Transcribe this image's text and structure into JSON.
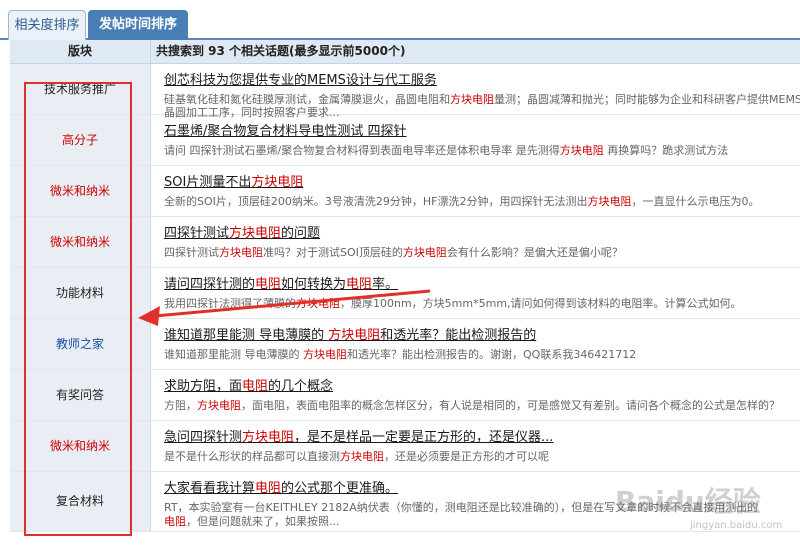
{
  "tabs": [
    {
      "label": "相关度排序"
    },
    {
      "label": "发帖时间排序"
    }
  ],
  "header": {
    "category_label": "版块",
    "results_label": "共搜索到 93 个相关话题(最多显示前5000个)"
  },
  "rows": [
    {
      "category": "技术服务推广",
      "title": "创芯科技为您提供专业的MEMS设计与代工服务",
      "desc_a": "硅基氧化硅和氮化硅膜厚测试，金属薄膜退火，晶圆电阻和",
      "desc_hl": "方块电阻",
      "desc_b": "量测；晶圆减薄和抛光；同时能够为企业和科研客户提供MEMS传感器的设计",
      "desc2": "晶圆加工工序，同时按照客户要求..."
    },
    {
      "category": "高分子",
      "title": "石墨烯/聚合物复合材料导电性测试 四探针",
      "desc_a": "请问 四探针测试石墨烯/聚合物复合材料得到表面电导率还是体积电导率 是先测得",
      "desc_hl": "方块电阻",
      "desc_b": " 再换算吗？跪求测试方法"
    },
    {
      "category": "微米和纳米",
      "title_a": "SOI片测量不出",
      "title_hl": "方块电阻",
      "desc_a": "全新的SOI片，顶层硅200纳米。3号液清洗29分钟，HF漂洗2分钟，用四探针无法测出",
      "desc_hl": "方块电阻",
      "desc_b": "，一直显什么示电压为0。"
    },
    {
      "category": "微米和纳米",
      "title_a": "四探针测试",
      "title_hl": "方块电阻",
      "title_b": "的问题",
      "desc_a": "四探针测试",
      "desc_hl": "方块电阻",
      "desc_b": "准吗？对于测试SOI顶层硅的",
      "desc_hl2": "方块电阻",
      "desc_c": "会有什么影响？是偏大还是偏小呢？"
    },
    {
      "category": "功能材料",
      "title_a": "请问四探针测的",
      "title_hl": "电阻",
      "title_b": "如何转换为",
      "title_hl2": "电阻",
      "title_c": "率。",
      "desc_a": "我用四探针法测得了薄膜的",
      "desc_hl": "方块电阻",
      "desc_b": "，膜厚100nm，方块5mm*5mm,请问如何得到该材料的电阻率。计算公式如何。"
    },
    {
      "category": "教师之家",
      "title_a": "谁知道那里能测 导电薄膜的 ",
      "title_hl": "方块电阻",
      "title_b": "和透光率？能出检测报告的",
      "desc_a": "谁知道那里能测 导电薄膜的 ",
      "desc_hl": "方块电阻",
      "desc_b": "和透光率？能出检测报告的。谢谢，QQ联系我346421712"
    },
    {
      "category": "有奖问答",
      "title_a": "求助方阻，面",
      "title_hl": "电阻",
      "title_b": "的几个概念",
      "desc_a": "方阻，",
      "desc_hl": "方块电阻",
      "desc_b": "，面电阻，表面电阻率的概念怎样区分，有人说是相同的，可是感觉又有差别。请问各个概念的公式是怎样的？"
    },
    {
      "category": "微米和纳米",
      "title_a": "急问四探针测",
      "title_hl": "方块电阻",
      "title_b": "，是不是样品一定要是正方形的，还是仪器...",
      "desc_a": "是不是什么形状的样品都可以直接测",
      "desc_hl": "方块电阻",
      "desc_b": "，还是必须要是正方形的才可以呢"
    },
    {
      "category": "复合材料",
      "title_a": "大家看看我计算",
      "title_hl": "电阻",
      "title_b": "的公式那个更准确。",
      "desc_a": "RT，本实验室有一台KEITHLEY 2182A纳伏表（你懂的，测电阻还是比较准确的），但是在写文章的时候不会直接用测出的",
      "desc2_hl": "电阻",
      "desc2": "，但是问题就来了，如果按照..."
    }
  ],
  "watermark": {
    "text": "Baidu经验",
    "sub": "jingyan.baidu.com"
  },
  "colors": {
    "tab_active": "#4a7fb5",
    "header_bg": "#dfe9f4",
    "category_bg": "#e9eef5",
    "highlight": "#cc0000",
    "annotation": "#e0302a"
  }
}
